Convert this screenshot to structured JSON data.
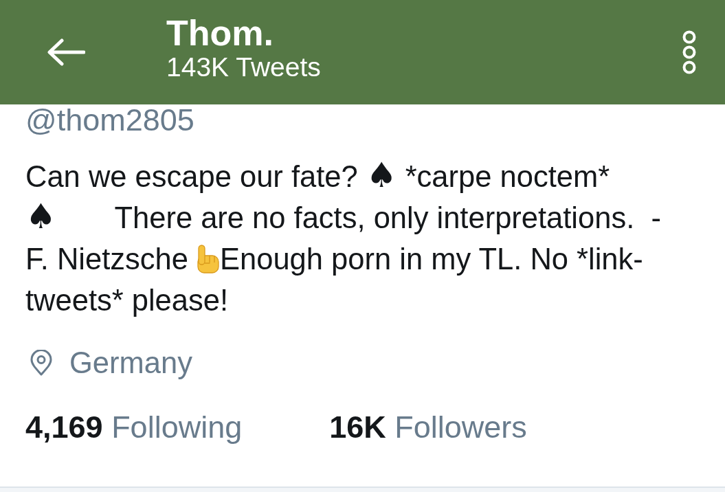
{
  "header": {
    "title": "Thom.",
    "subtitle": "143K Tweets"
  },
  "profile": {
    "handle": "@thom2805",
    "bio_before_emoji": "Can we escape our fate? ♠ *carpe noctem* ♠       There are no facts, only interpretations.  - F. Nietzsche ",
    "bio_after_emoji": "Enough porn in my TL. No *link-tweets* please!",
    "location": "Germany"
  },
  "stats": [
    {
      "count": "4,169",
      "label": "Following"
    },
    {
      "count": "16K",
      "label": "Followers"
    }
  ]
}
